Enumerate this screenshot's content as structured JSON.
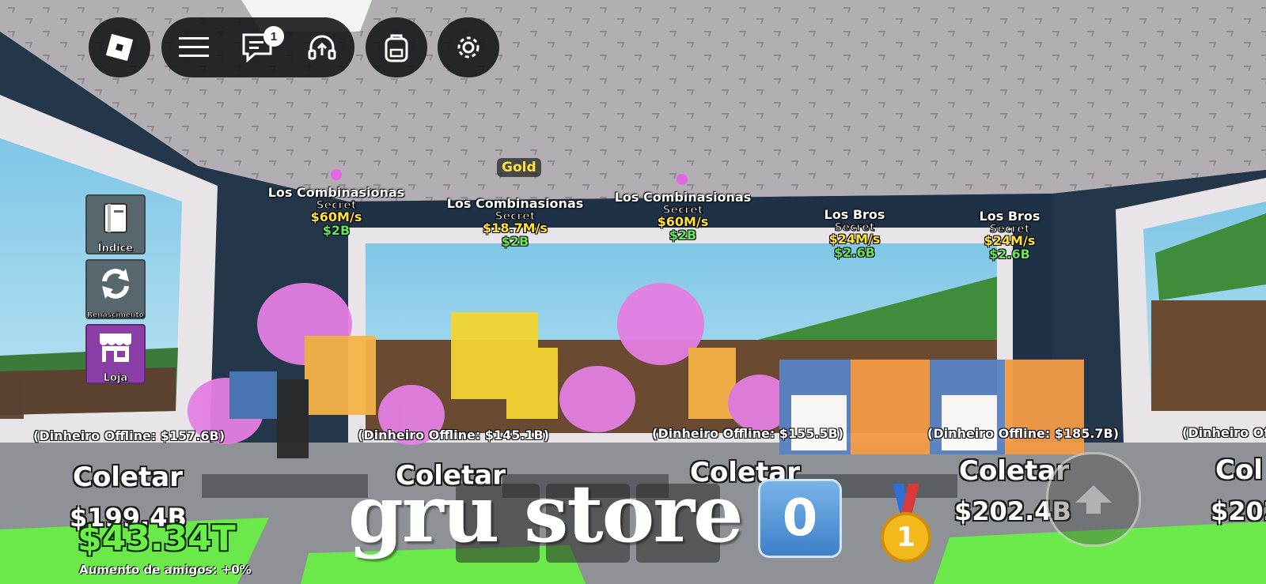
{
  "hud": {
    "roblox_icon": "roblox-logo-icon",
    "menu_icon": "hamburger-icon",
    "chat_icon": "chat-icon",
    "chat_badge": "1",
    "voice_icon": "headset-icon",
    "backpack_icon": "backpack-icon",
    "settings_icon": "gear-icon"
  },
  "side_menu": {
    "index_label": "Índice",
    "rebirth_label": "Renascimento",
    "shop_label": "Loja"
  },
  "gold_tag": "Gold",
  "pets": [
    {
      "name": "Los Combinasionas",
      "rarity": "Secret",
      "rate": "$60M/s",
      "price": "$2B"
    },
    {
      "name": "Los Combinasionas",
      "rarity": "Secret",
      "rate": "$18.7M/s",
      "price": "$2B"
    },
    {
      "name": "Los Combinasionas",
      "rarity": "Secret",
      "rate": "$60M/s",
      "price": "$2B"
    },
    {
      "name": "Los Bros",
      "rarity": "Secret",
      "rate": "$24M/s",
      "price": "$2.6B"
    },
    {
      "name": "Los Bros",
      "rarity": "Secret",
      "rate": "$24M/s",
      "price": "$2.6B"
    }
  ],
  "stands": [
    {
      "offline": "(Dinheiro Offline: $157.6B)",
      "collect": "Coletar",
      "amount": "$199.4B"
    },
    {
      "offline": "(Dinheiro Offline: $145.1B)",
      "collect": "Coletar",
      "amount": ""
    },
    {
      "offline": "(Dinheiro Offline: $155.5B)",
      "collect": "Coletar",
      "amount": ""
    },
    {
      "offline": "(Dinheiro Offline: $185.7B)",
      "collect": "Coletar",
      "amount": "$202.4B"
    },
    {
      "offline": "(Dinheiro Offli",
      "collect": "Col",
      "amount": "$202"
    }
  ],
  "money": "$43.34T",
  "friends_boost": "Aumento de amigos: +0%",
  "watermark": "gru store",
  "zero_key": "0",
  "medal_number": "1",
  "jump_icon": "arrow-up-icon",
  "colors": {
    "money": "#6bf04a",
    "rate": "#ffe23a",
    "price": "#5fe85a",
    "shop": "#8b3fa6"
  }
}
